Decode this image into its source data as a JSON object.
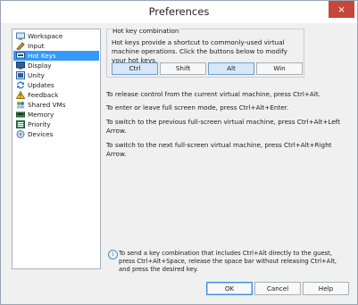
{
  "window": {
    "title": "Preferences",
    "close_icon": "×"
  },
  "sidebar": {
    "items": [
      {
        "label": "Workspace",
        "icon": "workspace-icon",
        "selected": false
      },
      {
        "label": "Input",
        "icon": "input-icon",
        "selected": false
      },
      {
        "label": "Hot Keys",
        "icon": "hot-keys-icon",
        "selected": true
      },
      {
        "label": "Display",
        "icon": "display-icon",
        "selected": false
      },
      {
        "label": "Unity",
        "icon": "unity-icon",
        "selected": false
      },
      {
        "label": "Updates",
        "icon": "updates-icon",
        "selected": false
      },
      {
        "label": "Feedback",
        "icon": "feedback-icon",
        "selected": false
      },
      {
        "label": "Shared VMs",
        "icon": "shared-vms-icon",
        "selected": false
      },
      {
        "label": "Memory",
        "icon": "memory-icon",
        "selected": false
      },
      {
        "label": "Priority",
        "icon": "priority-icon",
        "selected": false
      },
      {
        "label": "Devices",
        "icon": "devices-icon",
        "selected": false
      }
    ]
  },
  "hotkeys": {
    "group_label": "Hot key combination",
    "description": "Hot keys provide a shortcut to commonly-used virtual machine operations. Click the buttons below to modify your hot keys.",
    "buttons": [
      {
        "label": "Ctrl",
        "active": true
      },
      {
        "label": "Shift",
        "active": false
      },
      {
        "label": "Alt",
        "active": true
      },
      {
        "label": "Win",
        "active": false
      }
    ]
  },
  "info": [
    "To release control from the current virtual machine, press Ctrl+Alt.",
    "To enter or leave full screen mode, press Ctrl+Alt+Enter.",
    "To switch to the previous full-screen virtual machine, press Ctrl+Alt+Left Arrow.",
    "To switch to the next full-screen virtual machine, press Ctrl+Alt+Right Arrow."
  ],
  "tip": "To send a key combination that includes Ctrl+Alt directly to the guest, press Ctrl+Alt+Space, release the space bar without releasing Ctrl+Alt, and press the desired key.",
  "footer": {
    "ok": "OK",
    "cancel": "Cancel",
    "help": "Help"
  },
  "colors": {
    "selection": "#3399ff",
    "close": "#c7463a",
    "active_key": "#d7e7f8"
  }
}
